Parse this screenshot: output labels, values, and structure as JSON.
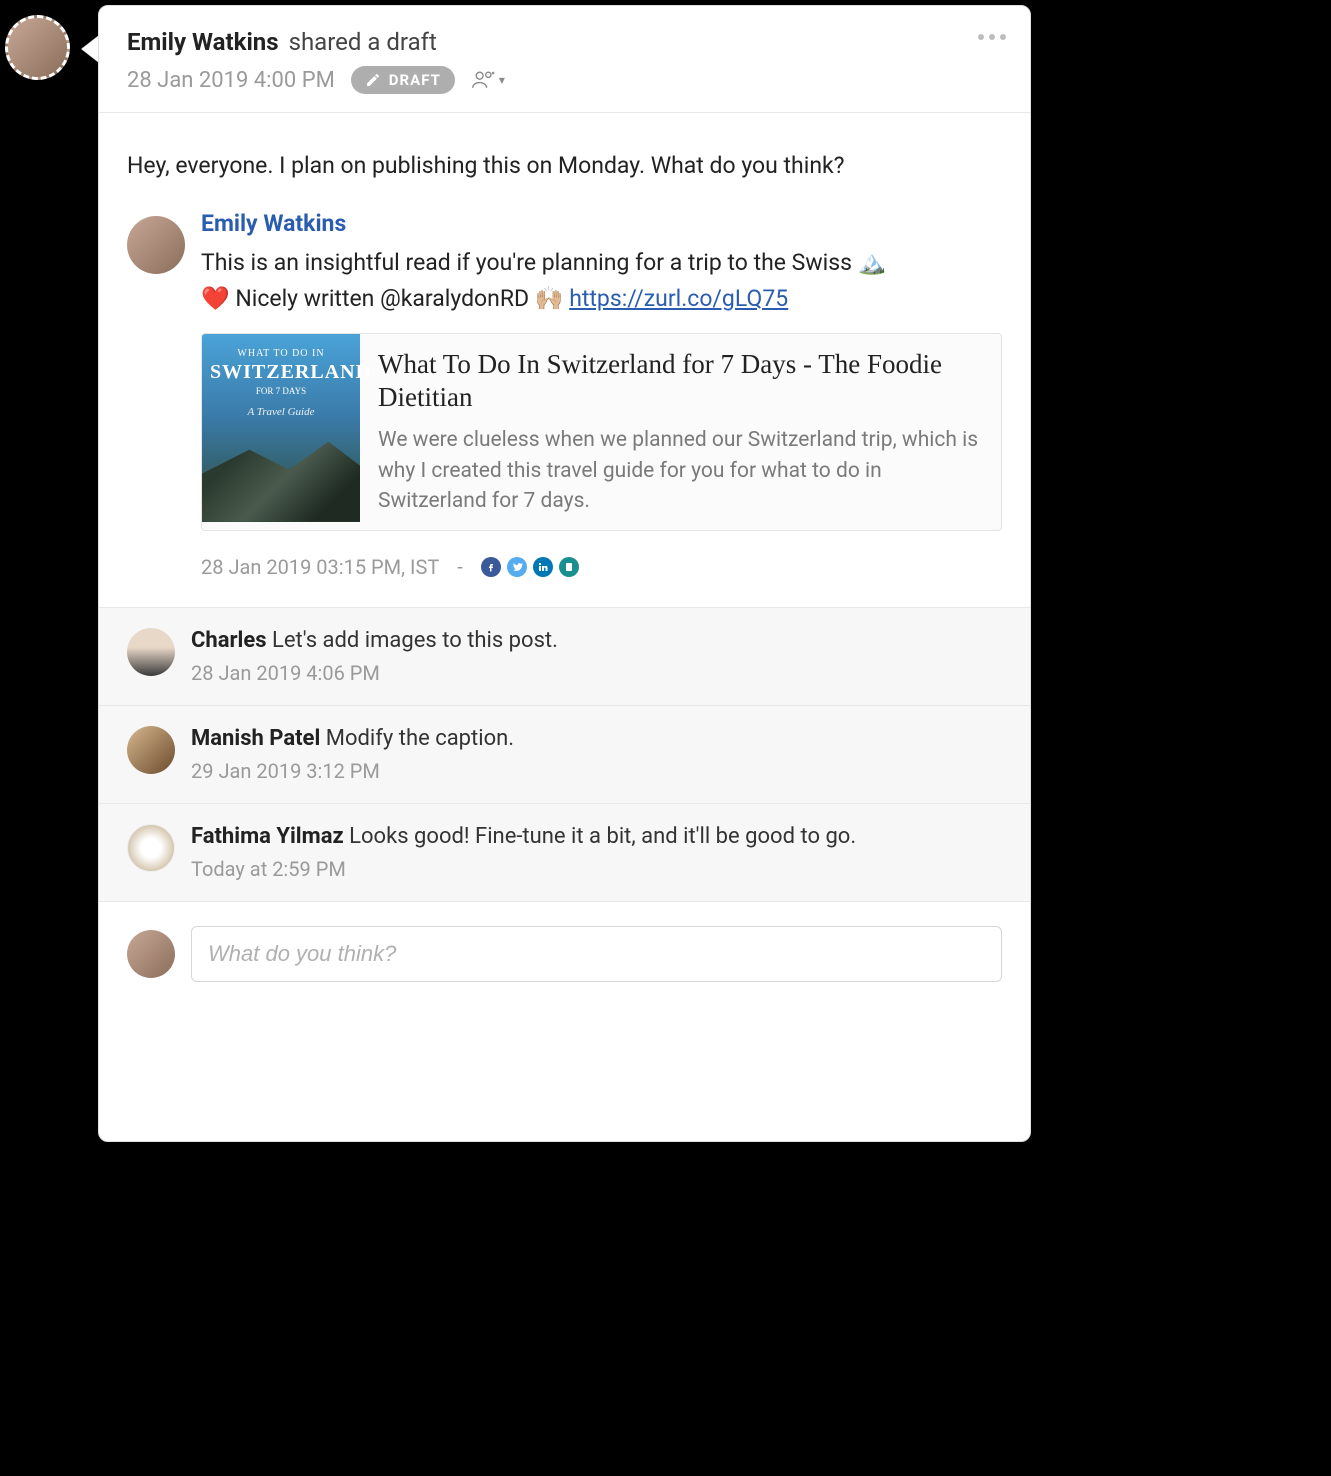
{
  "header": {
    "author": "Emily Watkins",
    "shared_text": "shared a draft",
    "timestamp": "28 Jan 2019 4:00 PM",
    "draft_badge": "DRAFT"
  },
  "body": {
    "message": "Hey, everyone. I plan on publishing this on Monday. What do you think?"
  },
  "draft": {
    "author": "Emily Watkins",
    "line1_before": "This is an insightful read if you're planning for a trip to the Swiss ",
    "line1_emoji": "🏔️",
    "line2_before": "❤️  Nicely written @karalydonRD 🙌🏼   ",
    "link_text": "https://zurl.co/gLQ75",
    "preview": {
      "thumb_line1": "WHAT TO DO IN",
      "thumb_line2": "SWITZERLAND",
      "thumb_line3": "FOR 7 DAYS",
      "thumb_line4": "A Travel Guide",
      "title": "What To Do In Switzerland for 7 Days - The Foodie Dietitian",
      "description": "We were clueless when we planned our Switzerland trip, which is why I created this travel guide for you for what to do in Switzerland for 7 days."
    },
    "meta_time": "28 Jan 2019 03:15 PM, IST",
    "meta_sep": "-"
  },
  "comments": [
    {
      "name": "Charles",
      "text": "Let's add images to this post.",
      "time": "28 Jan 2019 4:06 PM",
      "avatar_class": "av-charles"
    },
    {
      "name": "Manish Patel",
      "text": "Modify the caption.",
      "time": "29 Jan 2019 3:12 PM",
      "avatar_class": "av-manish"
    },
    {
      "name": "Fathima Yilmaz",
      "text": "Looks good! Fine-tune it a bit, and it'll be good to go.",
      "time": "Today at 2:59 PM",
      "avatar_class": "av-fathima"
    }
  ],
  "compose": {
    "placeholder": "What do you think?"
  }
}
